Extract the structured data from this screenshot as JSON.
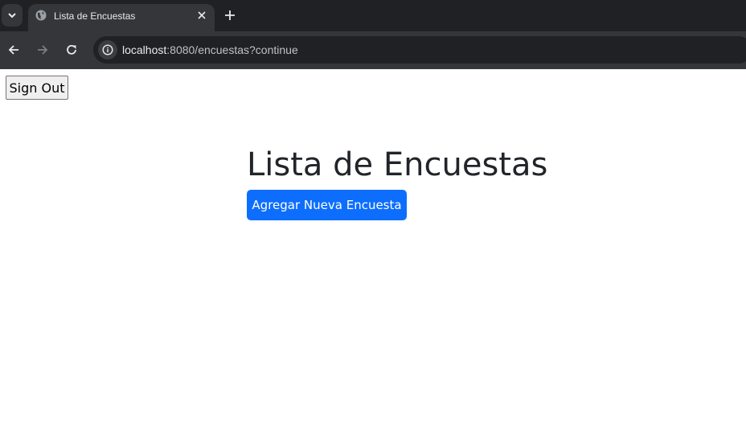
{
  "browser": {
    "tab": {
      "title": "Lista de Encuestas"
    },
    "address_bar": {
      "host": "localhost",
      "rest": ":8080/encuestas?continue"
    },
    "icons": [
      "tab-search-icon",
      "globe-icon",
      "close-icon",
      "plus-icon",
      "back-arrow-icon",
      "forward-arrow-icon",
      "reload-icon",
      "info-icon"
    ]
  },
  "page": {
    "signout_label": "Sign Out",
    "title": "Lista de Encuestas",
    "add_button_label": "Agregar Nueva Encuesta"
  },
  "colors": {
    "primary_button": "#0d6efd",
    "heading_text": "#212529",
    "chrome_dark": "#202124",
    "chrome_toolbar": "#35363a"
  }
}
